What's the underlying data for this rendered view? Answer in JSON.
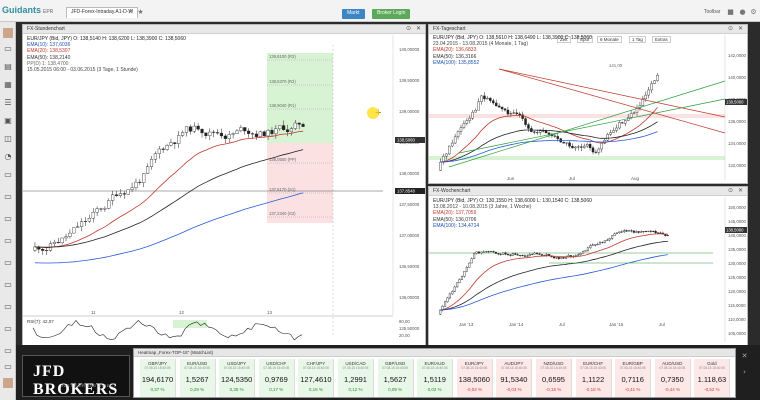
{
  "topbar": {
    "logo": "Guidants",
    "logo_sub": "EPR",
    "tab1": "JFD-Forex-Intraday.A1-D-W",
    "btn_market": "Markt",
    "btn_login": "Broker Login",
    "tools": "Toolbar"
  },
  "chart_main": {
    "title": "FX-Stundenchart",
    "legend": [
      {
        "text": "EUR/JPY (Bid, JPY)  O: 138,5140  H: 138,6200  L: 138,3900  C: 138,5060",
        "color": "#222"
      },
      {
        "text": "EMA(10): 137,6036",
        "color": "#1a4fb5"
      },
      {
        "text": "EMA(20): 138,5307",
        "color": "#c0392b"
      },
      {
        "text": "EMA(50): 138,2140",
        "color": "#333"
      },
      {
        "text": "PP(D)  1: 138,4700",
        "color": "#666"
      },
      {
        "text": "15.05.2015 06:00 - 03.06.2015 (3 Tage, 1 Stunde)",
        "color": "#444"
      }
    ],
    "levels": [
      "139,8100 (R3)",
      "138,5370 (R2)",
      "138,9040 (R1)",
      "138,0500 (PP)",
      "137,6170 (S1)",
      "137,2340 (S2)"
    ],
    "y_labels": [
      "140,00000",
      "139,50000",
      "139,00000",
      "138,50000",
      "138,00000",
      "137,50000",
      "137,00000",
      "136,50000",
      "136,00000",
      "135,50000"
    ],
    "x_labels": [
      "11",
      "12",
      "13"
    ],
    "price_tag": "138,5060",
    "price_tag2": "137,8548",
    "rsi_label": "RSI(7): 42,07",
    "rsi_levels": [
      "80,00",
      "20,00"
    ]
  },
  "chart_daily": {
    "title": "FX-Tageschart",
    "legend": [
      {
        "text": "EUR/JPY (Bid, JPY)  O: 138,5610  H: 138,6490  L: 138,3900  C: 138,5060",
        "color": "#222"
      },
      {
        "text": "23.04.2015 - 13.08.2015 (4 Monate, 1 Tag)",
        "color": "#444"
      },
      {
        "text": "EMA(20): 136,6833",
        "color": "#c0392b"
      },
      {
        "text": "EMA(50): 136,3166",
        "color": "#333"
      },
      {
        "text": "EMA(100): 135,8552",
        "color": "#1a4fb5"
      }
    ],
    "toolbar": [
      "Zeit",
      "Spur",
      "6 Monate",
      "1 Tag",
      "Extras"
    ],
    "y_labels": [
      "142,0000",
      "140,0000",
      "138,0000",
      "136,0000",
      "134,0000",
      "132,0000"
    ],
    "x_labels": [
      "Jun",
      "Jul",
      "Aug"
    ],
    "price_tag": "138,5060",
    "annot": "141,00"
  },
  "chart_weekly": {
    "title": "FX-Wochenchart",
    "legend": [
      {
        "text": "EUR/JPY (Bid, JPY)  O: 130,1550  H: 138,6000  L: 130,1540  C: 138,5060",
        "color": "#222"
      },
      {
        "text": "13.08.2012 - 10.08.2015 (3 Jahre, 1 Woche)",
        "color": "#444"
      },
      {
        "text": "EMA(20): 137,7059",
        "color": "#c0392b"
      },
      {
        "text": "EMA(50): 136,0706",
        "color": "#333"
      },
      {
        "text": "EMA(100): 134,4714",
        "color": "#1a4fb5"
      }
    ],
    "y_labels": [
      "150,0000",
      "145,0000",
      "140,0000",
      "135,0000",
      "130,0000",
      "125,0000",
      "120,0000",
      "115,0000",
      "110,0000",
      "105,0000"
    ],
    "x_labels": [
      "Jan '13",
      "Jan '14",
      "Jul",
      "Jan '15",
      "Jul"
    ],
    "price_tag": "138,5060"
  },
  "brand": {
    "name": "JFD BROKERS",
    "tagline": "JUST FAIR AND DIRECT"
  },
  "watchlist": {
    "title": "Heatmap „Forex-TOP-15\" (WatchList)",
    "tiles": [
      {
        "name": "GBP/JPY",
        "date": "07.08.15 15:40:05",
        "price": "194,6170",
        "chg": "0,37 %",
        "neg": false
      },
      {
        "name": "EUR/USD",
        "date": "07.08.15 15:40:05",
        "price": "1,5267",
        "chg": "0,29 %",
        "neg": false
      },
      {
        "name": "USD/JPY",
        "date": "07.08.15 15:40:05",
        "price": "124,5350",
        "chg": "0,35 %",
        "neg": false
      },
      {
        "name": "USD/CHF",
        "date": "07.08.15 15:40:05",
        "price": "0,9769",
        "chg": "0,17 %",
        "neg": false
      },
      {
        "name": "CHF/JPY",
        "date": "07.08.15 15:40:05",
        "price": "127,4610",
        "chg": "0,15 %",
        "neg": false
      },
      {
        "name": "USD/CAD",
        "date": "07.08.15 15:40:05",
        "price": "1,2991",
        "chg": "0,12 %",
        "neg": false
      },
      {
        "name": "GBP/USD",
        "date": "07.08.15 15:40:05",
        "price": "1,5627",
        "chg": "0,09 %",
        "neg": false
      },
      {
        "name": "EUR/AUD",
        "date": "07.08.15 15:40:05",
        "price": "1,5119",
        "chg": "0,02 %",
        "neg": false
      },
      {
        "name": "EUR/JPY",
        "date": "07.08.15 15:40:05",
        "price": "138,5060",
        "chg": "-0,04 %",
        "neg": true
      },
      {
        "name": "AUD/JPY",
        "date": "07.08.15 15:40:05",
        "price": "91,5340",
        "chg": "-0,03 %",
        "neg": true
      },
      {
        "name": "NZD/USD",
        "date": "07.08.15 15:40:05",
        "price": "0,6595",
        "chg": "-0,15 %",
        "neg": true
      },
      {
        "name": "EUR/CHF",
        "date": "07.08.15 15:40:05",
        "price": "1,1122",
        "chg": "-0,18 %",
        "neg": true
      },
      {
        "name": "EUR/GBP",
        "date": "07.08.15 15:40:05",
        "price": "0,7116",
        "chg": "-0,41 %",
        "neg": true
      },
      {
        "name": "AUD/USD",
        "date": "07.08.15 15:40:05",
        "price": "0,7350",
        "chg": "-0,44 %",
        "neg": true
      },
      {
        "name": "Gold",
        "date": "07.08.15 15:40:05",
        "price": "1.118,63",
        "chg": "-0,52 %",
        "neg": true
      }
    ]
  }
}
